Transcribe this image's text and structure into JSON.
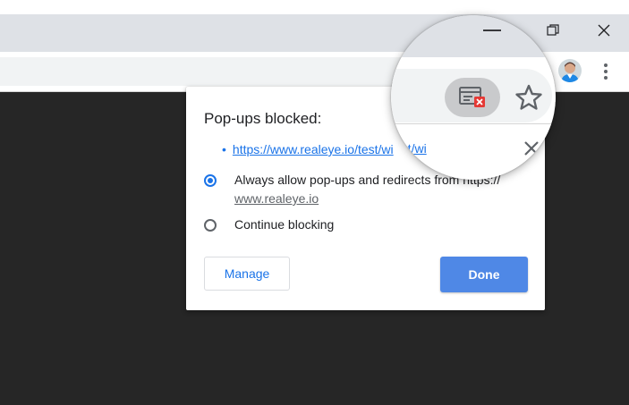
{
  "window_controls": {
    "minimize": "minimize",
    "restore": "restore",
    "close": "close"
  },
  "icons": {
    "minimize": "minimize-icon",
    "restore": "restore-icon",
    "close": "close-icon",
    "popup_blocked": "popup-blocked-icon",
    "bookmark_star": "star-icon",
    "menu": "kebab-menu-icon",
    "dialog_close": "close-icon"
  },
  "popup": {
    "title": "Pop-ups blocked:",
    "blocked_link": "https://www.realeye.io/test/wi",
    "magnified_link_fragment": "test/wi",
    "options": [
      {
        "label_before": "Always allow pop-ups and redirects from https://",
        "label_site": "www.realeye.io",
        "checked": true
      },
      {
        "label": "Continue blocking",
        "checked": false
      }
    ],
    "manage_label": "Manage",
    "done_label": "Done"
  },
  "colors": {
    "accent": "#1a73e8",
    "done_button": "#4f88e6",
    "page_background": "#262626",
    "titlebar": "#dee1e6",
    "blocked_badge": "#e53935"
  }
}
